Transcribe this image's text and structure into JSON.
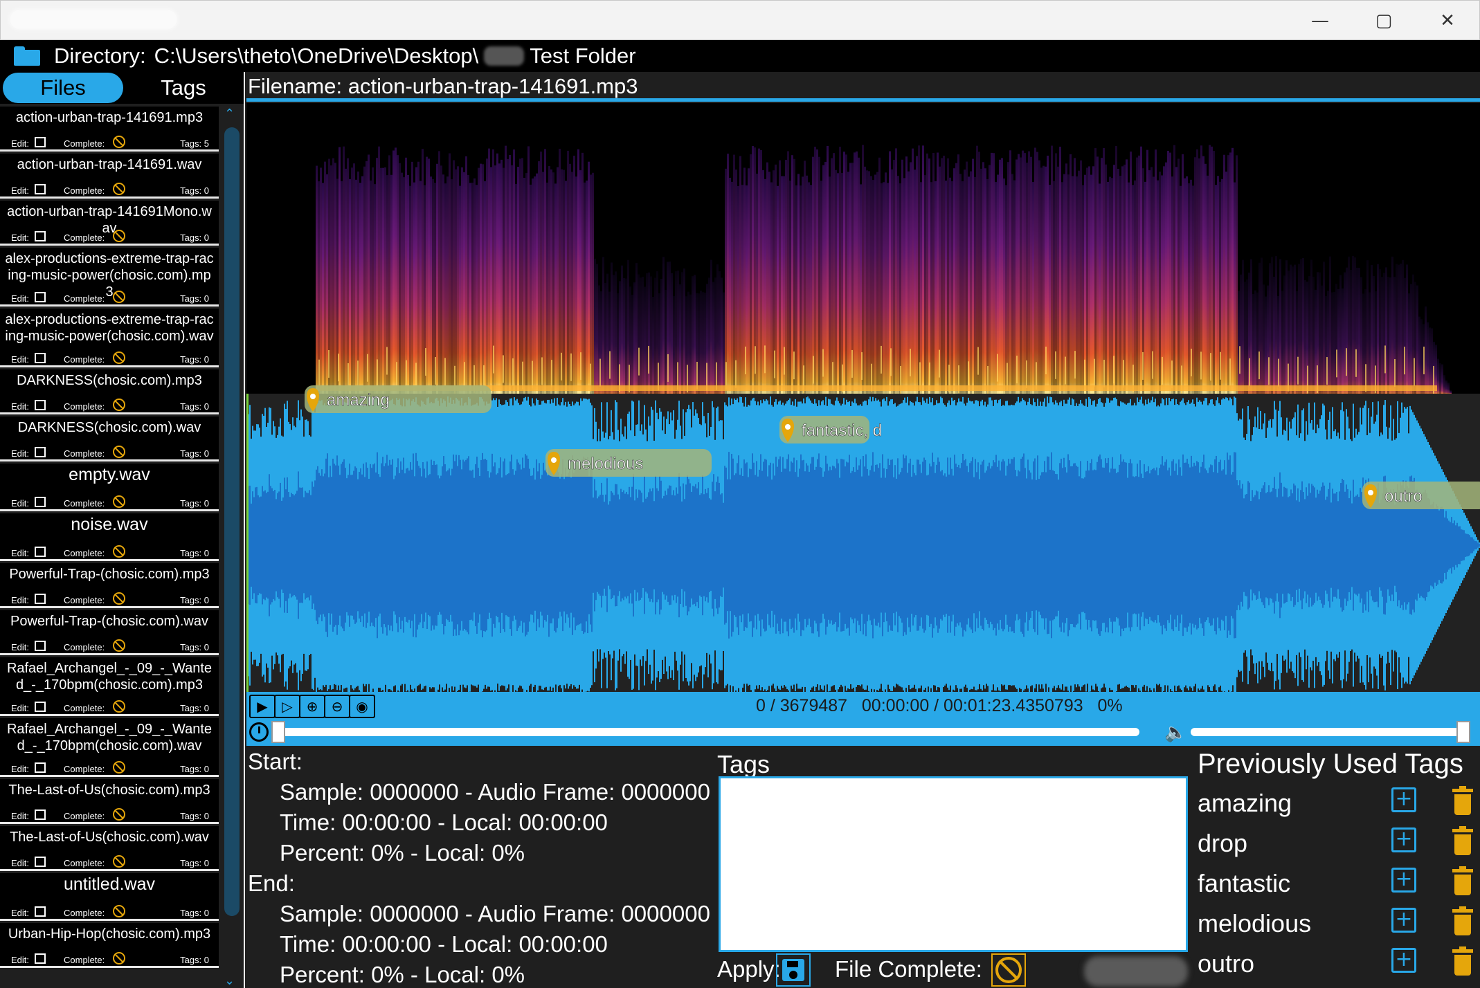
{
  "window": {
    "minimize_glyph": "—",
    "maximize_glyph": "▢",
    "close_glyph": "✕"
  },
  "directory": {
    "label": "Directory:",
    "path": "C:\\Users\\theto\\OneDrive\\Desktop\\",
    "tail": "Test Folder"
  },
  "tabs": {
    "files": "Files",
    "tags": "Tags"
  },
  "files": [
    {
      "name": "action-urban-trap-141691.mp3",
      "tags": "Tags: 5",
      "big": false
    },
    {
      "name": "action-urban-trap-141691.wav",
      "tags": "Tags: 0",
      "big": false
    },
    {
      "name": "action-urban-trap-141691Mono.wav",
      "tags": "Tags: 0",
      "big": false
    },
    {
      "name": "alex-productions-extreme-trap-racing-music-power(chosic.com).mp3",
      "tags": "Tags: 0",
      "big": false
    },
    {
      "name": "alex-productions-extreme-trap-racing-music-power(chosic.com).wav",
      "tags": "Tags: 0",
      "big": false
    },
    {
      "name": "DARKNESS(chosic.com).mp3",
      "tags": "Tags: 0",
      "big": false
    },
    {
      "name": "DARKNESS(chosic.com).wav",
      "tags": "Tags: 0",
      "big": false
    },
    {
      "name": "empty.wav",
      "tags": "Tags: 0",
      "big": true
    },
    {
      "name": "noise.wav",
      "tags": "Tags: 0",
      "big": true
    },
    {
      "name": "Powerful-Trap-(chosic.com).mp3",
      "tags": "Tags: 0",
      "big": false
    },
    {
      "name": "Powerful-Trap-(chosic.com).wav",
      "tags": "Tags: 0",
      "big": false
    },
    {
      "name": "Rafael_Archangel_-_09_-_Wanted_-_170bpm(chosic.com).mp3",
      "tags": "Tags: 0",
      "big": false
    },
    {
      "name": "Rafael_Archangel_-_09_-_Wanted_-_170bpm(chosic.com).wav",
      "tags": "Tags: 0",
      "big": false
    },
    {
      "name": "The-Last-of-Us(chosic.com).mp3",
      "tags": "Tags: 0",
      "big": false
    },
    {
      "name": "The-Last-of-Us(chosic.com).wav",
      "tags": "Tags: 0",
      "big": false
    },
    {
      "name": "untitled.wav",
      "tags": "Tags: 0",
      "big": true
    },
    {
      "name": "Urban-Hip-Hop(chosic.com).mp3",
      "tags": "Tags: 0",
      "big": false
    }
  ],
  "file_meta": {
    "edit_label": "Edit:",
    "complete_label": "Complete:"
  },
  "filename": {
    "label": "Filename:",
    "value": "action-urban-trap-141691.mp3"
  },
  "markers": [
    {
      "label": "amazing"
    },
    {
      "label": "melodious"
    },
    {
      "label": "fantastic, d"
    },
    {
      "label": "outro"
    }
  ],
  "player": {
    "readout": "0 / 3679487   00:00:00 / 00:01:23.4350793   0%",
    "play_glyph": "▶",
    "play_sel_glyph": "▷",
    "zoom_in_glyph": "⊕",
    "zoom_out_glyph": "⊖",
    "view_glyph": "◉",
    "volume_glyph": "🔈",
    "seek_fraction": 0,
    "volume_fraction": 1.0
  },
  "selection": {
    "start_label": "Start:",
    "start_sample": "Sample: 0000000 - Audio Frame: 0000000",
    "start_time": "Time: 00:00:00 - Local: 00:00:00",
    "start_percent": "Percent: 0% - Local: 0%",
    "end_label": "End:",
    "end_sample": "Sample: 0000000 - Audio Frame: 0000000",
    "end_time": "Time: 00:00:00 - Local: 00:00:00",
    "end_percent": "Percent: 0% - Local: 0%"
  },
  "tags_panel": {
    "label": "Tags",
    "value": "",
    "apply_label": "Apply:",
    "file_complete_label": "File Complete:"
  },
  "previous_tags": {
    "title": "Previously Used Tags",
    "items": [
      "amazing",
      "drop",
      "fantastic",
      "melodious",
      "outro"
    ]
  },
  "colors": {
    "accent": "#29a8e8",
    "warning": "#e5a60b",
    "wave_light": "#29a8e8",
    "wave_dark": "#1c73c9",
    "marker_bg": "#a3b57a"
  }
}
